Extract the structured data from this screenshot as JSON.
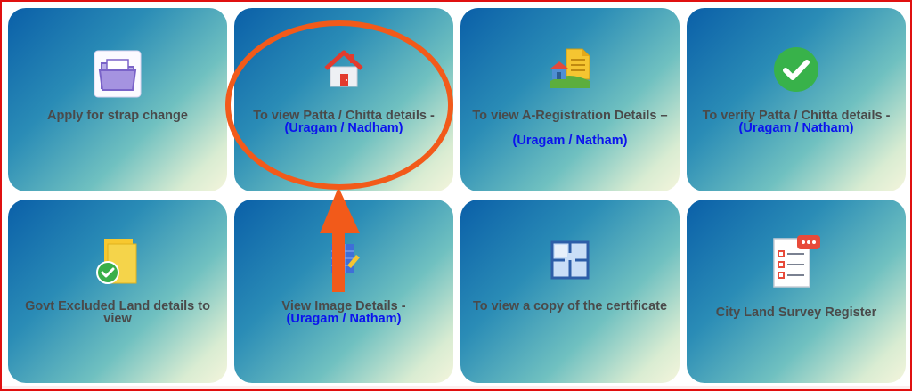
{
  "tiles": [
    {
      "title": "Apply for strap change",
      "sub": "",
      "icon": "folder-icon"
    },
    {
      "title": "To view Patta / Chitta details -",
      "sub": "(Uragam / Nadham)",
      "icon": "house-icon"
    },
    {
      "title": "To view A-Registration Details –",
      "sub": "(Uragam / Natham)",
      "icon": "village-document-icon"
    },
    {
      "title": "To verify Patta / Chitta details -",
      "sub": "(Uragam / Natham)",
      "icon": "check-circle-icon"
    },
    {
      "title": "Govt Excluded Land details to view",
      "sub": "",
      "icon": "document-check-icon"
    },
    {
      "title": "View Image Details -",
      "sub": "(Uragam / Natham)",
      "icon": "image-ruler-icon"
    },
    {
      "title": "To view a copy of the certificate",
      "sub": "",
      "icon": "floor-plan-icon"
    },
    {
      "title": "City Land Survey Register",
      "sub": "",
      "icon": "checklist-chat-icon"
    }
  ],
  "colors": {
    "frame": "#e01010",
    "annotation": "#f25a1a",
    "label": "#4a4a4a",
    "sublabel": "#0b13ee"
  }
}
